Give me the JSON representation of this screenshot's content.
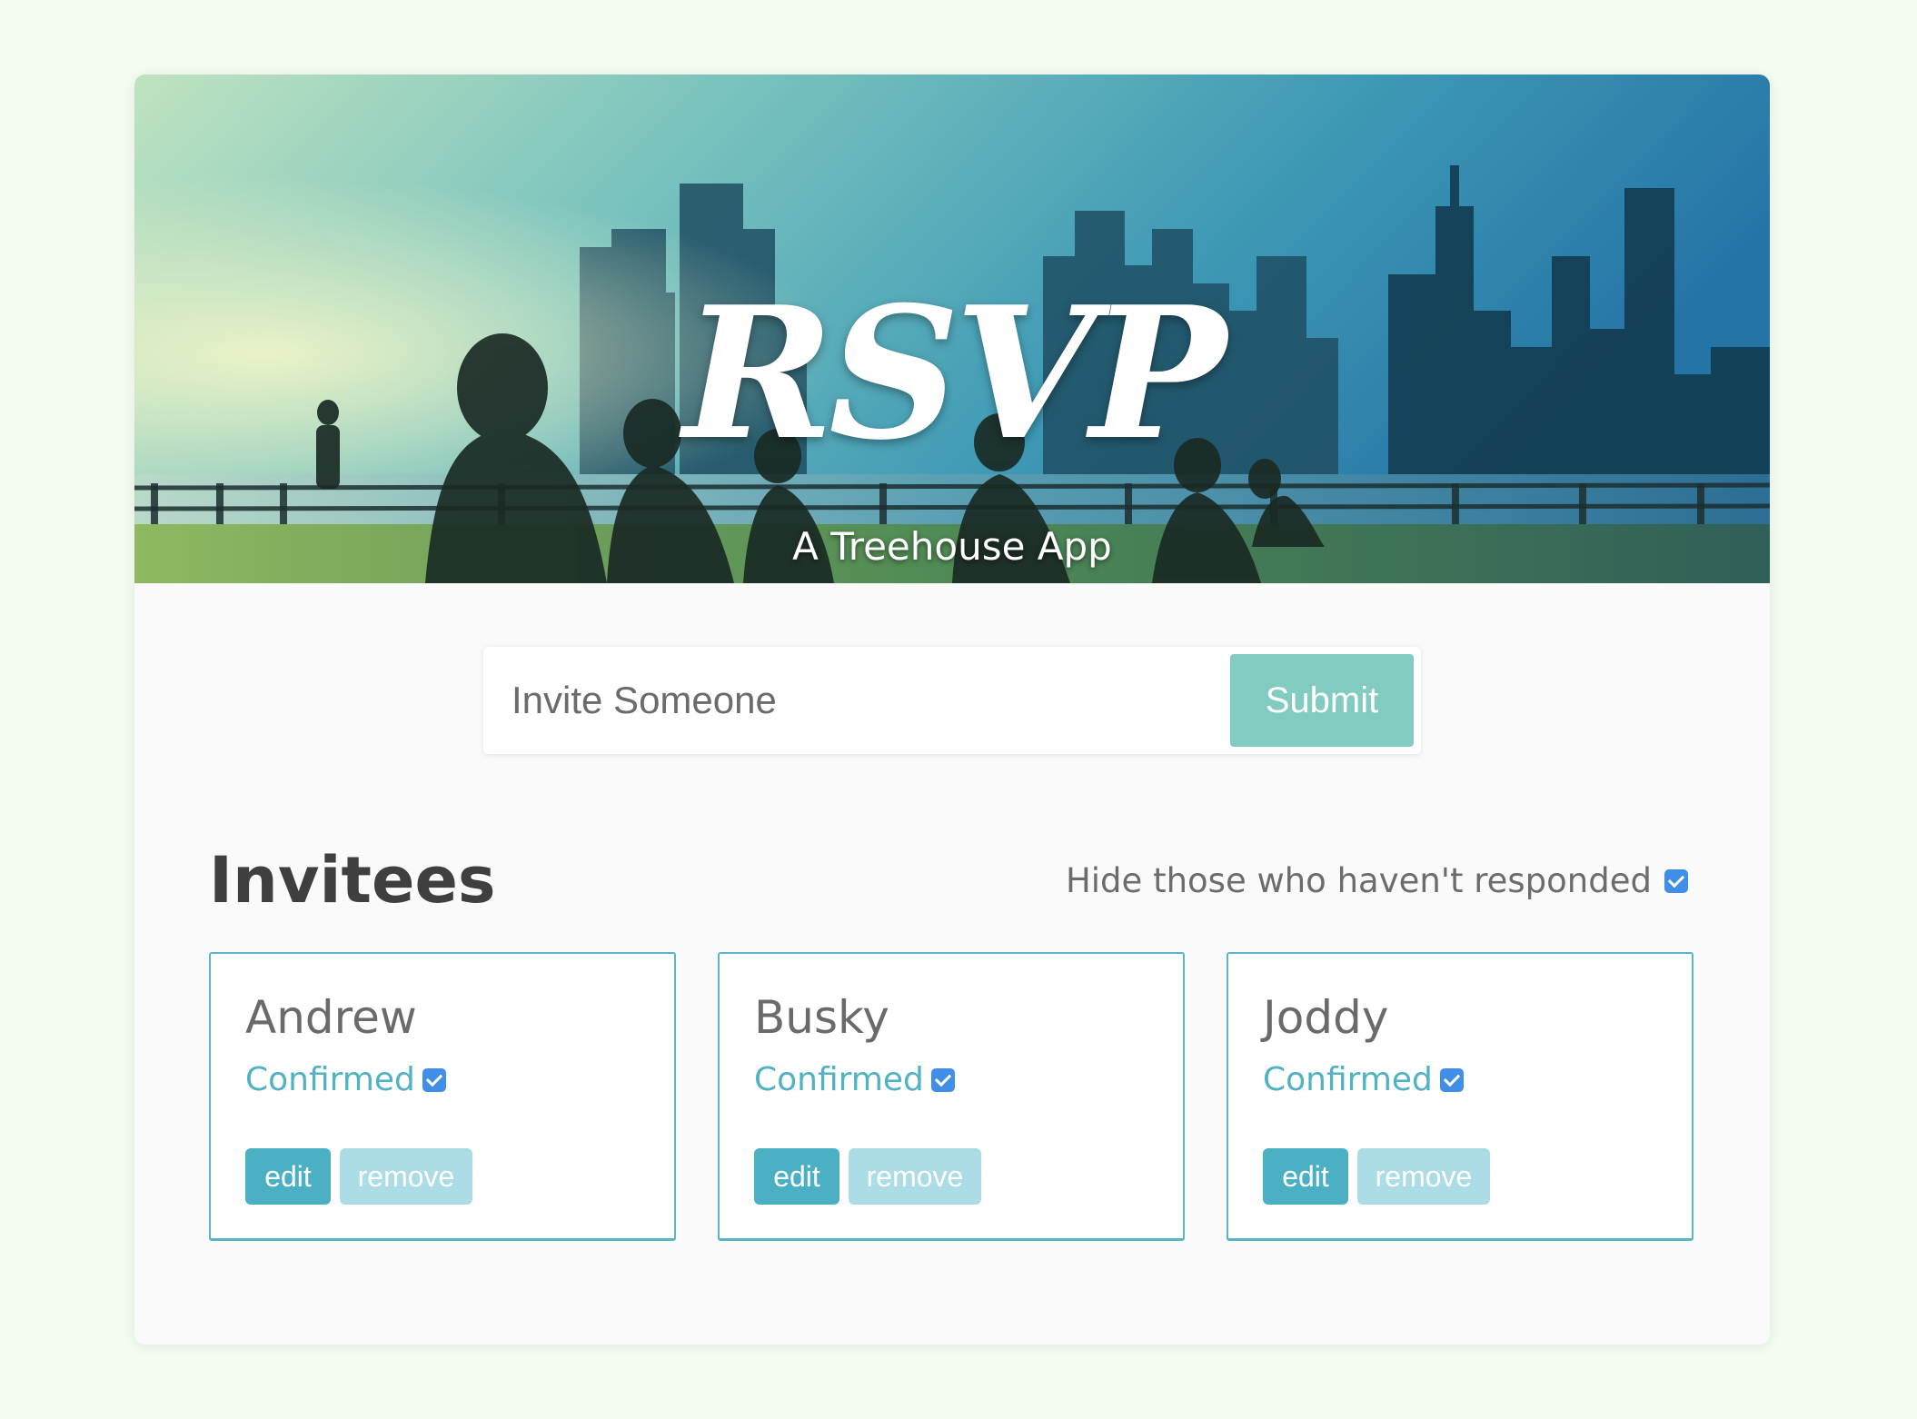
{
  "header": {
    "title": "RSVP",
    "subtitle": "A Treehouse App"
  },
  "form": {
    "placeholder": "Invite Someone",
    "submit_label": "Submit"
  },
  "main": {
    "heading": "Invitees",
    "filter": {
      "label": "Hide those who haven't responded",
      "checked": true
    }
  },
  "invitees": [
    {
      "name": "Andrew",
      "status": "Confirmed",
      "confirmed": true,
      "edit_label": "edit",
      "remove_label": "remove"
    },
    {
      "name": "Busky",
      "status": "Confirmed",
      "confirmed": true,
      "edit_label": "edit",
      "remove_label": "remove"
    },
    {
      "name": "Joddy",
      "status": "Confirmed",
      "confirmed": true,
      "edit_label": "edit",
      "remove_label": "remove"
    }
  ],
  "colors": {
    "accent": "#4cb0c4",
    "accent_light": "#acdde6",
    "submit": "#82cbc1",
    "checkbox": "#3f8fe8",
    "page_background": "#f4fbf1"
  }
}
